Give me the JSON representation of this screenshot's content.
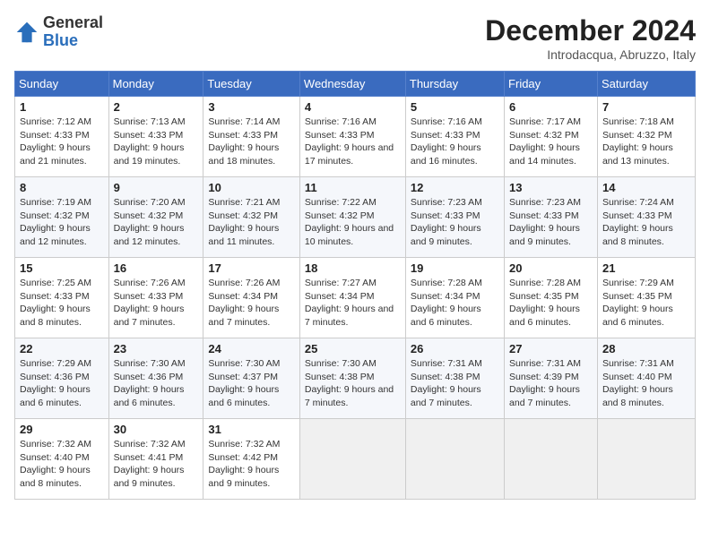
{
  "header": {
    "logo_general": "General",
    "logo_blue": "Blue",
    "month_title": "December 2024",
    "location": "Introdacqua, Abruzzo, Italy"
  },
  "weekdays": [
    "Sunday",
    "Monday",
    "Tuesday",
    "Wednesday",
    "Thursday",
    "Friday",
    "Saturday"
  ],
  "weeks": [
    [
      {
        "day": "1",
        "sunrise": "7:12 AM",
        "sunset": "4:33 PM",
        "daylight": "9 hours and 21 minutes."
      },
      {
        "day": "2",
        "sunrise": "7:13 AM",
        "sunset": "4:33 PM",
        "daylight": "9 hours and 19 minutes."
      },
      {
        "day": "3",
        "sunrise": "7:14 AM",
        "sunset": "4:33 PM",
        "daylight": "9 hours and 18 minutes."
      },
      {
        "day": "4",
        "sunrise": "7:16 AM",
        "sunset": "4:33 PM",
        "daylight": "9 hours and 17 minutes."
      },
      {
        "day": "5",
        "sunrise": "7:16 AM",
        "sunset": "4:33 PM",
        "daylight": "9 hours and 16 minutes."
      },
      {
        "day": "6",
        "sunrise": "7:17 AM",
        "sunset": "4:32 PM",
        "daylight": "9 hours and 14 minutes."
      },
      {
        "day": "7",
        "sunrise": "7:18 AM",
        "sunset": "4:32 PM",
        "daylight": "9 hours and 13 minutes."
      }
    ],
    [
      {
        "day": "8",
        "sunrise": "7:19 AM",
        "sunset": "4:32 PM",
        "daylight": "9 hours and 12 minutes."
      },
      {
        "day": "9",
        "sunrise": "7:20 AM",
        "sunset": "4:32 PM",
        "daylight": "9 hours and 12 minutes."
      },
      {
        "day": "10",
        "sunrise": "7:21 AM",
        "sunset": "4:32 PM",
        "daylight": "9 hours and 11 minutes."
      },
      {
        "day": "11",
        "sunrise": "7:22 AM",
        "sunset": "4:32 PM",
        "daylight": "9 hours and 10 minutes."
      },
      {
        "day": "12",
        "sunrise": "7:23 AM",
        "sunset": "4:33 PM",
        "daylight": "9 hours and 9 minutes."
      },
      {
        "day": "13",
        "sunrise": "7:23 AM",
        "sunset": "4:33 PM",
        "daylight": "9 hours and 9 minutes."
      },
      {
        "day": "14",
        "sunrise": "7:24 AM",
        "sunset": "4:33 PM",
        "daylight": "9 hours and 8 minutes."
      }
    ],
    [
      {
        "day": "15",
        "sunrise": "7:25 AM",
        "sunset": "4:33 PM",
        "daylight": "9 hours and 8 minutes."
      },
      {
        "day": "16",
        "sunrise": "7:26 AM",
        "sunset": "4:33 PM",
        "daylight": "9 hours and 7 minutes."
      },
      {
        "day": "17",
        "sunrise": "7:26 AM",
        "sunset": "4:34 PM",
        "daylight": "9 hours and 7 minutes."
      },
      {
        "day": "18",
        "sunrise": "7:27 AM",
        "sunset": "4:34 PM",
        "daylight": "9 hours and 7 minutes."
      },
      {
        "day": "19",
        "sunrise": "7:28 AM",
        "sunset": "4:34 PM",
        "daylight": "9 hours and 6 minutes."
      },
      {
        "day": "20",
        "sunrise": "7:28 AM",
        "sunset": "4:35 PM",
        "daylight": "9 hours and 6 minutes."
      },
      {
        "day": "21",
        "sunrise": "7:29 AM",
        "sunset": "4:35 PM",
        "daylight": "9 hours and 6 minutes."
      }
    ],
    [
      {
        "day": "22",
        "sunrise": "7:29 AM",
        "sunset": "4:36 PM",
        "daylight": "9 hours and 6 minutes."
      },
      {
        "day": "23",
        "sunrise": "7:30 AM",
        "sunset": "4:36 PM",
        "daylight": "9 hours and 6 minutes."
      },
      {
        "day": "24",
        "sunrise": "7:30 AM",
        "sunset": "4:37 PM",
        "daylight": "9 hours and 6 minutes."
      },
      {
        "day": "25",
        "sunrise": "7:30 AM",
        "sunset": "4:38 PM",
        "daylight": "9 hours and 7 minutes."
      },
      {
        "day": "26",
        "sunrise": "7:31 AM",
        "sunset": "4:38 PM",
        "daylight": "9 hours and 7 minutes."
      },
      {
        "day": "27",
        "sunrise": "7:31 AM",
        "sunset": "4:39 PM",
        "daylight": "9 hours and 7 minutes."
      },
      {
        "day": "28",
        "sunrise": "7:31 AM",
        "sunset": "4:40 PM",
        "daylight": "9 hours and 8 minutes."
      }
    ],
    [
      {
        "day": "29",
        "sunrise": "7:32 AM",
        "sunset": "4:40 PM",
        "daylight": "9 hours and 8 minutes."
      },
      {
        "day": "30",
        "sunrise": "7:32 AM",
        "sunset": "4:41 PM",
        "daylight": "9 hours and 9 minutes."
      },
      {
        "day": "31",
        "sunrise": "7:32 AM",
        "sunset": "4:42 PM",
        "daylight": "9 hours and 9 minutes."
      },
      null,
      null,
      null,
      null
    ]
  ]
}
